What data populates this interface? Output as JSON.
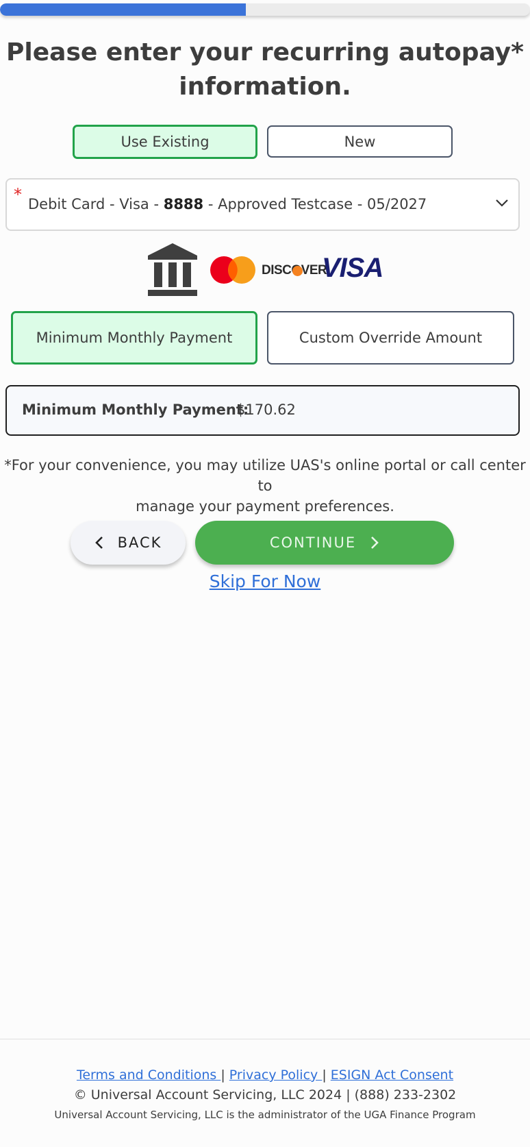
{
  "progress": {
    "value": 0.464,
    "fill_color": "#3b73d9"
  },
  "header": {
    "title_line1": "Please enter your recurring autopay*",
    "title_line2": "information."
  },
  "payment_source": {
    "options": [
      "Use Existing",
      "New"
    ],
    "selected": "Use Existing"
  },
  "payment_method_select": {
    "required_marker": "*",
    "prefix": "Debit Card - Visa - ",
    "last4": "8888",
    "suffix": " - Approved Testcase - 05/2027"
  },
  "payment_icons": [
    "bank-icon",
    "mastercard-icon",
    "discover-icon",
    "visa-icon"
  ],
  "brand_text": {
    "discover": "DISCOVER",
    "visa": "VISA"
  },
  "amount_type": {
    "options": [
      "Minimum Monthly Payment",
      "Custom Override Amount"
    ],
    "selected": "Minimum Monthly Payment"
  },
  "summary": {
    "label": "Minimum Monthly Payment:",
    "value": "$170.62"
  },
  "note": {
    "line1": "*For your convenience, you may utilize UAS's online portal or call center to",
    "line2": "manage your payment preferences."
  },
  "actions": {
    "back_label": "BACK",
    "continue_label": "CONTINUE",
    "skip_label": "Skip For Now"
  },
  "footer": {
    "links": [
      "Terms and Conditions ",
      "Privacy Policy ",
      "ESIGN Act Consent"
    ],
    "separator": "|",
    "copyright": "© Universal Account Servicing, LLC 2024 | (888) 233-2302",
    "admin_note": "Universal Account Servicing, LLC is the administrator of the UGA Finance Program"
  },
  "colors": {
    "accent_green": "#4caf50",
    "selected_bg": "#dcfce7",
    "selected_border": "#22a34a",
    "link_blue": "#2f6fd8",
    "required_red": "#e02424"
  }
}
